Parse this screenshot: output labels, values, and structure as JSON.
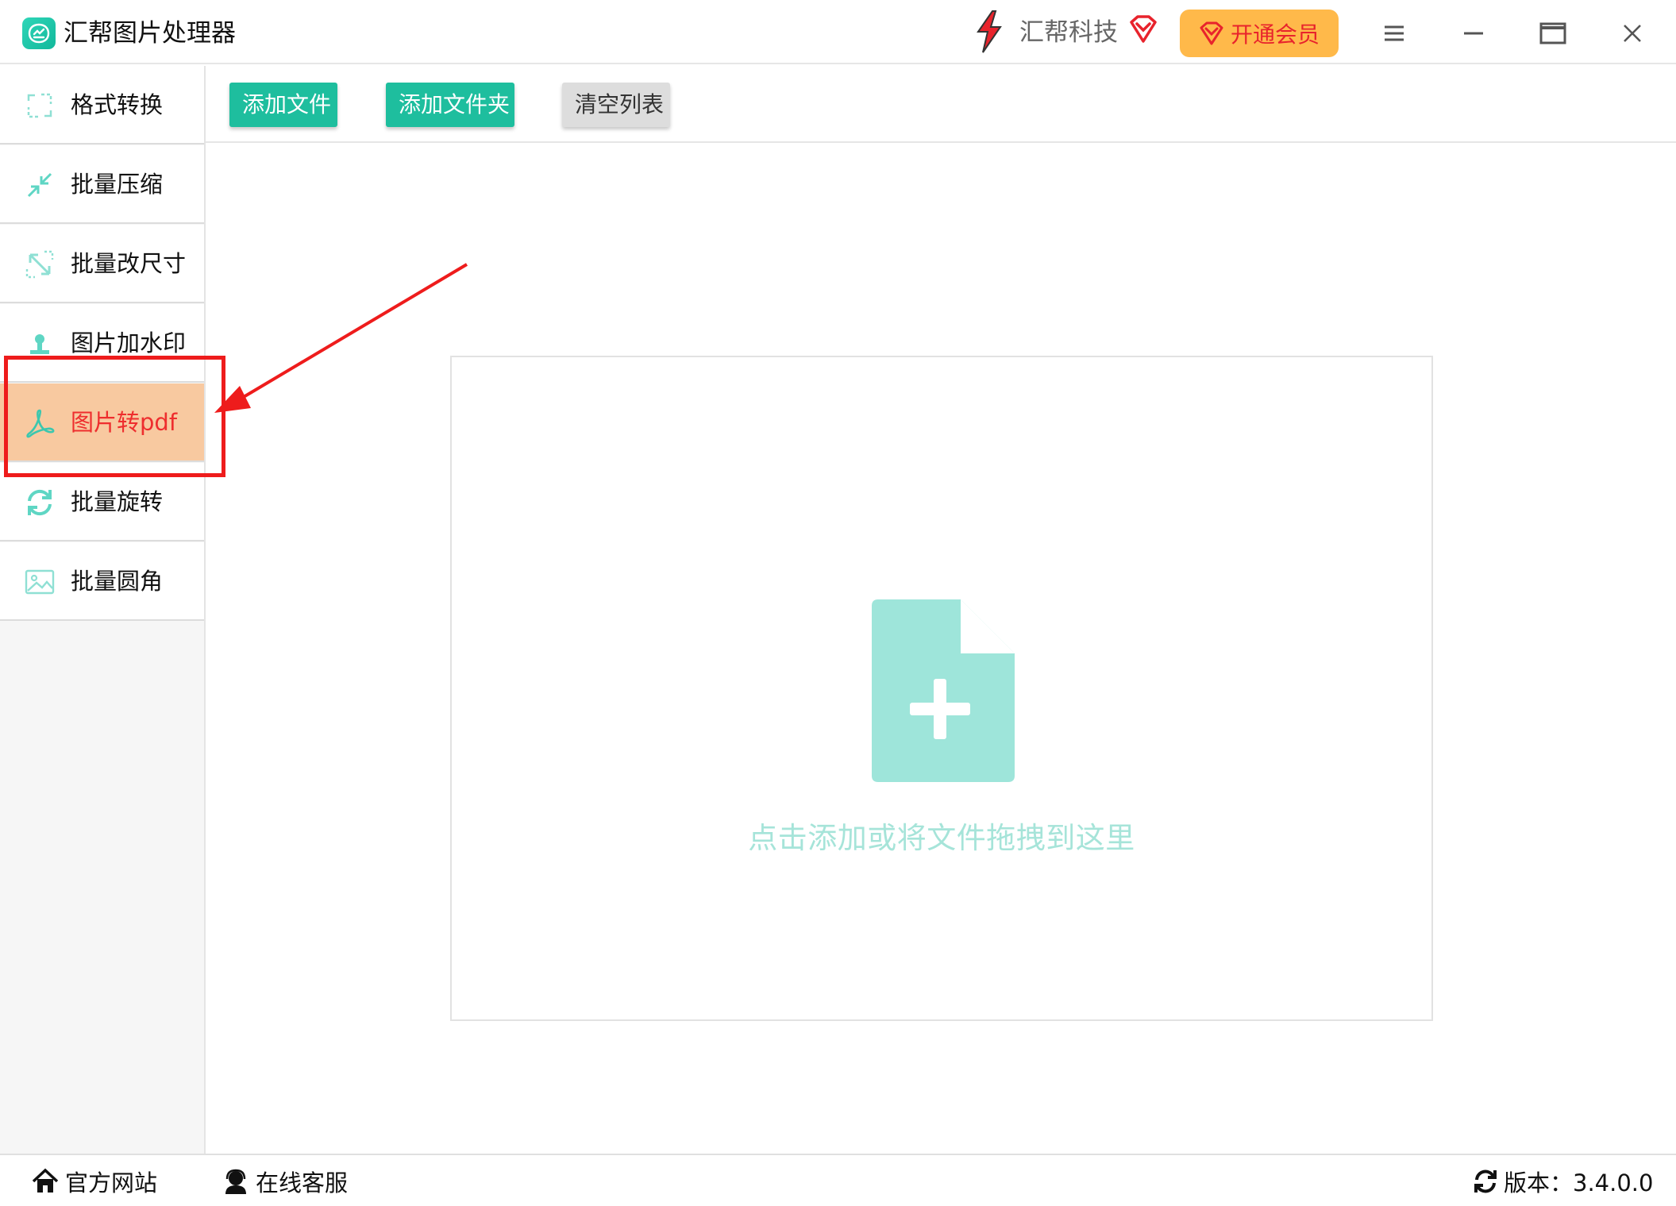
{
  "app": {
    "title": "汇帮图片处理器",
    "brand_name": "汇帮科技",
    "vip_label": "开通会员"
  },
  "colors": {
    "accent": "#1ebe9e",
    "active_item_bg": "#f8c9a0",
    "active_item_text": "#ee2e2e",
    "vip_bg": "#ffb94a",
    "annotation": "#ee1c1c",
    "drop_icon": "#9ee5da"
  },
  "sidebar": {
    "items": [
      {
        "label": "格式转换",
        "icon": "format-convert-icon"
      },
      {
        "label": "批量压缩",
        "icon": "compress-icon"
      },
      {
        "label": "批量改尺寸",
        "icon": "resize-icon"
      },
      {
        "label": "图片加水印",
        "icon": "watermark-icon"
      },
      {
        "label": "图片转pdf",
        "icon": "pdf-icon",
        "active": true
      },
      {
        "label": "批量旋转",
        "icon": "rotate-icon"
      },
      {
        "label": "批量圆角",
        "icon": "image-corner-icon"
      }
    ]
  },
  "toolbar": {
    "add_file": "添加文件",
    "add_folder": "添加文件夹",
    "clear_list": "清空列表"
  },
  "dropzone": {
    "hint": "点击添加或将文件拖拽到这里",
    "icon": "add-file-icon"
  },
  "statusbar": {
    "website": "官方网站",
    "support": "在线客服",
    "version": "版本：3.4.0.0"
  }
}
